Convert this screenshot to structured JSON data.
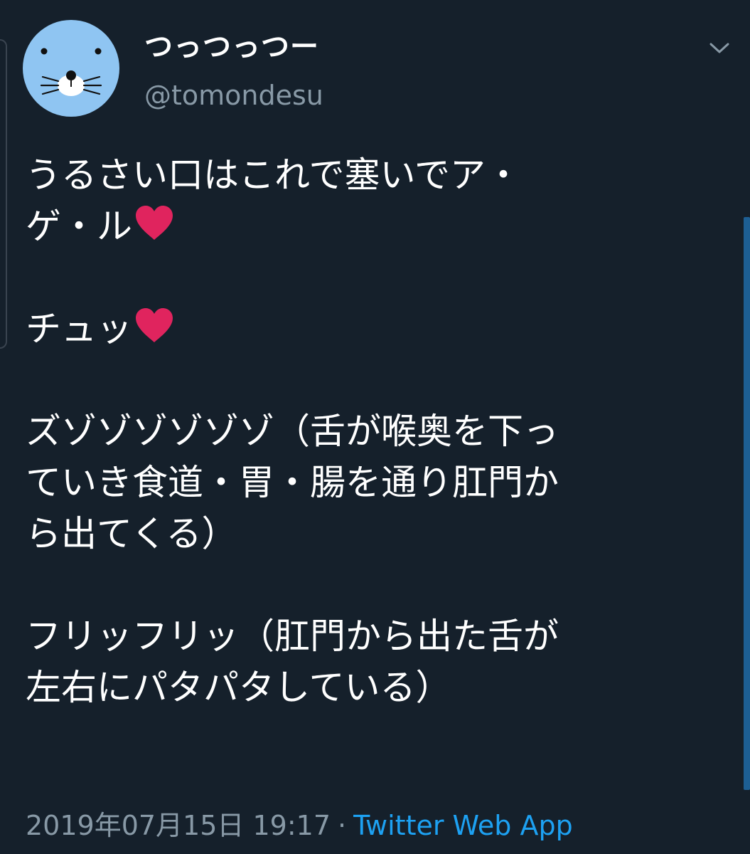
{
  "user": {
    "display_name": "つっつっつー",
    "handle": "@tomondesu"
  },
  "tweet": {
    "paragraphs": [
      {
        "lines": [
          "うるさい口はこれで塞いでア・",
          "ゲ・ル"
        ],
        "ends_with_heart": true
      },
      {
        "lines": [
          "チュッ"
        ],
        "ends_with_heart": true
      },
      {
        "lines": [
          "ズゾゾゾゾゾゾ（舌が喉奥を下っ",
          "ていき食道・胃・腸を通り肛門か",
          "ら出てくる）"
        ],
        "ends_with_heart": false
      },
      {
        "lines": [
          "フリッフリッ（肛門から出た舌が",
          "左右にパタパタしている）"
        ],
        "ends_with_heart": false
      }
    ]
  },
  "meta": {
    "timestamp": "2019年07月15日 19:17",
    "separator": "·",
    "source": "Twitter Web App"
  },
  "icons": {
    "avatar": "seal-face-avatar",
    "more": "chevron-down-icon",
    "heart": "red-heart-emoji"
  },
  "colors": {
    "background": "#15202b",
    "text": "#ffffff",
    "secondary": "#8899a6",
    "link": "#1da1f2",
    "heart": "#e0245e",
    "avatar_bg": "#8fc5f2"
  }
}
